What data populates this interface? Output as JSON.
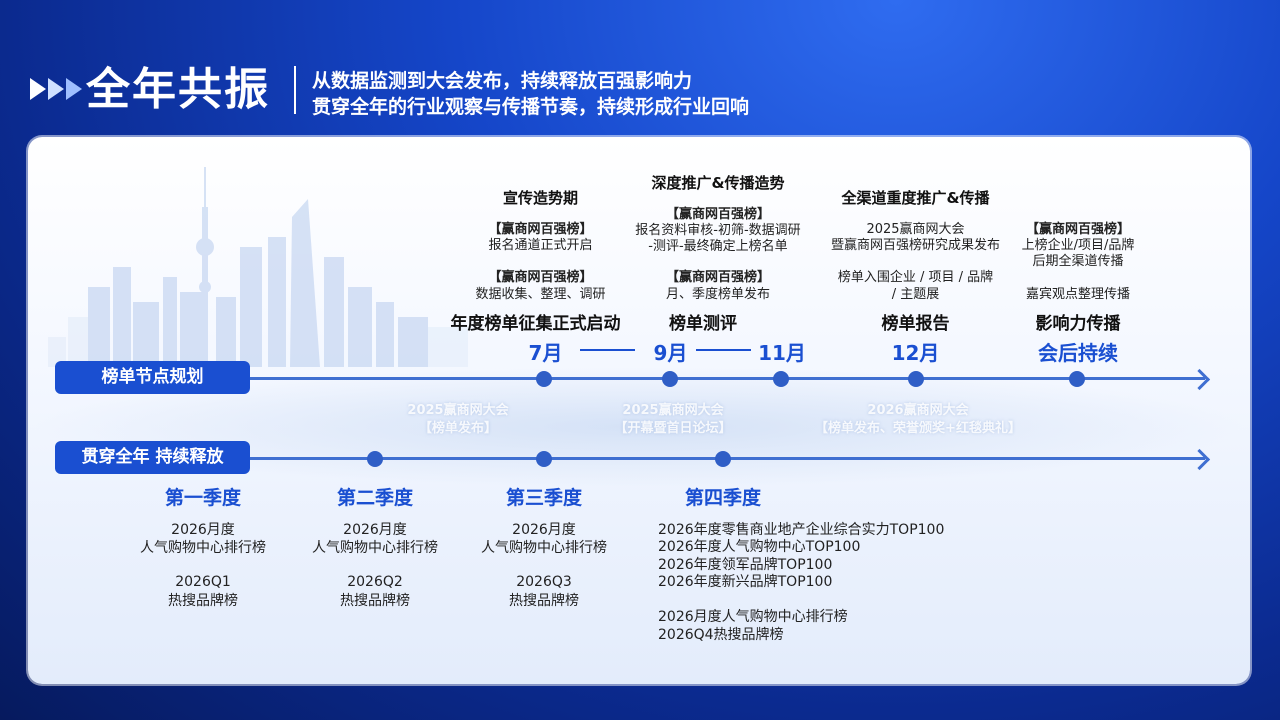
{
  "header": {
    "title": "全年共振",
    "subtitle_line1": "从数据监测到大会发布，持续释放百强影响力",
    "subtitle_line2": "贯穿全年的行业观察与传播节奏，持续形成行业回响"
  },
  "timeline1": {
    "label": "榜单节点规划",
    "columns": [
      {
        "phase": "宣传造势期",
        "blocks": [
          {
            "tag": "【赢商网百强榜】",
            "text": "报名通道正式开启"
          },
          {
            "tag": "【赢商网百强榜】",
            "text": "数据收集、整理、调研"
          }
        ],
        "milestone": "年度榜单征集正式启动",
        "month": "7月"
      },
      {
        "phase": "深度推广&传播造势",
        "blocks": [
          {
            "tag": "【赢商网百强榜】",
            "text": "报名资料审核-初筛-数据调研",
            "text2": "-测评-最终确定上榜名单"
          },
          {
            "tag": "【赢商网百强榜】",
            "text": "月、季度榜单发布"
          }
        ],
        "milestone": "榜单测评",
        "month": "9月",
        "month2": "11月"
      },
      {
        "phase": "全渠道重度推广&传播",
        "blocks": [
          {
            "text": "2025赢商网大会",
            "text2": "暨赢商网百强榜研究成果发布"
          },
          {
            "text": "榜单入围企业 / 项目 / 品牌",
            "text2": "/ 主题展"
          }
        ],
        "milestone": "榜单报告",
        "month": "12月"
      },
      {
        "blocks": [
          {
            "tag": "【赢商网百强榜】",
            "text": "上榜企业/项目/品牌",
            "text2": "后期全渠道传播"
          },
          {
            "text": "嘉宾观点整理传播"
          }
        ],
        "milestone": "影响力传播",
        "month": "会后持续"
      }
    ],
    "ghost": [
      {
        "line1": "2025赢商网大会",
        "line2": "【榜单发布】"
      },
      {
        "line1": "2025赢商网大会",
        "line2": "【开幕暨首日论坛】"
      },
      {
        "line1": "2026赢商网大会",
        "line2": "【榜单发布、荣誉颁奖+红毯典礼】"
      }
    ]
  },
  "timeline2": {
    "label": "贯穿全年  持续释放",
    "quarters": [
      {
        "name": "第一季度",
        "lines": [
          "2026月度",
          "人气购物中心排行榜",
          "",
          "2026Q1",
          "热搜品牌榜"
        ]
      },
      {
        "name": "第二季度",
        "lines": [
          "2026月度",
          "人气购物中心排行榜",
          "",
          "2026Q2",
          "热搜品牌榜"
        ]
      },
      {
        "name": "第三季度",
        "lines": [
          "2026月度",
          "人气购物中心排行榜",
          "",
          "2026Q3",
          "热搜品牌榜"
        ]
      },
      {
        "name": "第四季度",
        "lines": [
          "2026年度零售商业地产企业综合实力TOP100",
          "2026年度人气购物中心TOP100",
          "2026年度领军品牌TOP100",
          "2026年度新兴品牌TOP100",
          "",
          "2026月度人气购物中心排行榜",
          "2026Q4热搜品牌榜"
        ]
      }
    ]
  },
  "colors": {
    "accent": "#1a4fd1",
    "line": "#3f6fd1",
    "dot": "#2f5ec6"
  }
}
